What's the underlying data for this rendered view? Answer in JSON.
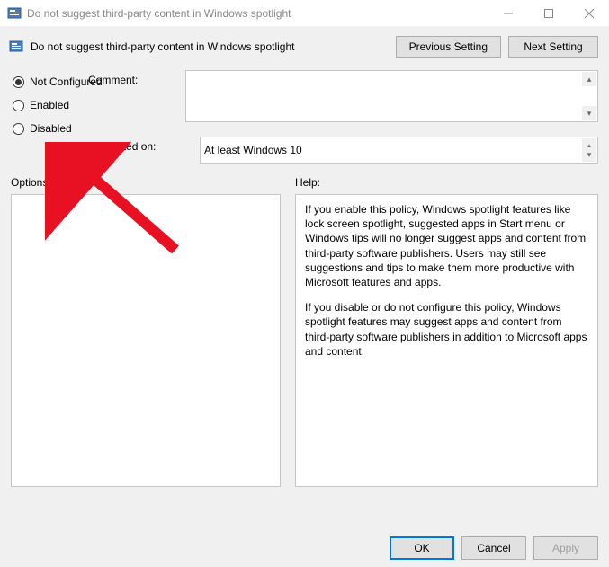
{
  "window": {
    "title": "Do not suggest third-party content in Windows spotlight"
  },
  "policy": {
    "icon_name": "policy-icon",
    "title": "Do not suggest third-party content in Windows spotlight"
  },
  "nav": {
    "previous": "Previous Setting",
    "next": "Next Setting"
  },
  "state": {
    "options": {
      "not_configured": "Not Configured",
      "enabled": "Enabled",
      "disabled": "Disabled"
    },
    "selected": "not_configured"
  },
  "fields": {
    "comment_label": "Comment:",
    "comment_value": "",
    "supported_label": "Supported on:",
    "supported_value": "At least Windows 10"
  },
  "sections": {
    "options_label": "Options:",
    "help_label": "Help:"
  },
  "help": {
    "p1": "If you enable this policy, Windows spotlight features like lock screen spotlight, suggested apps in Start menu or Windows tips will no longer suggest apps and content from third-party software publishers. Users may still see suggestions and tips to make them more productive with Microsoft features and apps.",
    "p2": "If you disable or do not configure this policy, Windows spotlight features may suggest apps and content from third-party software publishers in addition to Microsoft apps and content."
  },
  "footer": {
    "ok": "OK",
    "cancel": "Cancel",
    "apply": "Apply"
  },
  "annotation": {
    "arrow_target": "disabled"
  }
}
